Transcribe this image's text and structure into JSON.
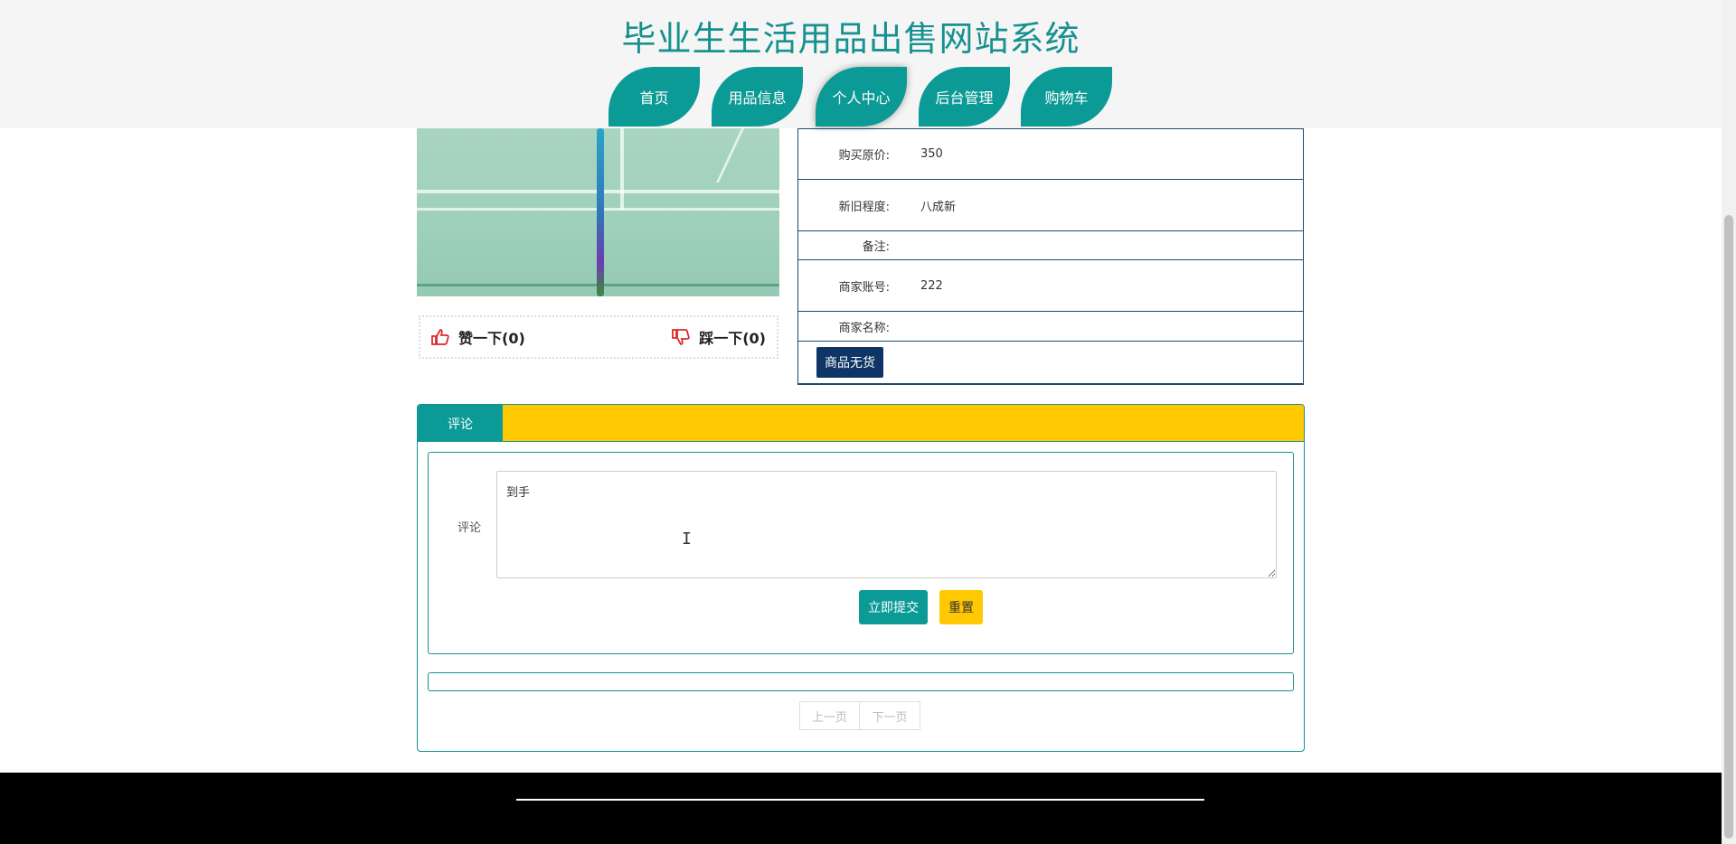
{
  "header": {
    "title": "毕业生生活用品出售网站系统",
    "nav": [
      "首页",
      "用品信息",
      "个人中心",
      "后台管理",
      "购物车"
    ],
    "active_index": 2
  },
  "product": {
    "likes": {
      "like_label": "赞一下(0)",
      "dislike_label": "踩一下(0)"
    },
    "info": [
      {
        "label": "购买原价:",
        "value": "350"
      },
      {
        "label": "新旧程度:",
        "value": "八成新"
      },
      {
        "label": "备注:",
        "value": ""
      },
      {
        "label": "商家账号:",
        "value": "222"
      },
      {
        "label": "商家名称:",
        "value": ""
      }
    ],
    "stock_button": "商品无货"
  },
  "comments": {
    "tab_label": "评论",
    "form_label": "评论",
    "input_value": "到手",
    "submit_label": "立即提交",
    "reset_label": "重置",
    "prev_label": "上一页",
    "next_label": "下一页"
  },
  "colors": {
    "accent": "#0c9a96",
    "tab_bar": "#ffc800",
    "dark_button": "#0e3565"
  }
}
